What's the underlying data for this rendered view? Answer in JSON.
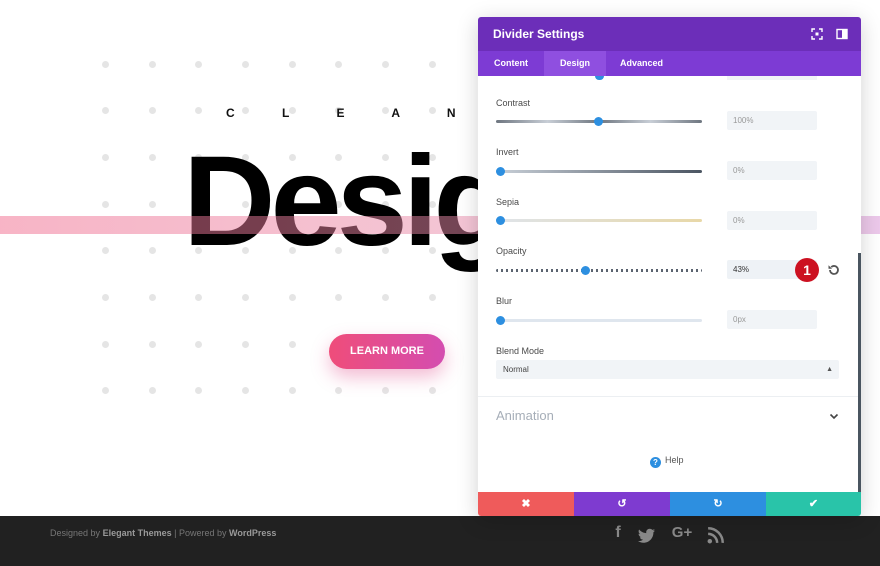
{
  "page": {
    "tagline": "C L E A N   &   W H",
    "headline": "Desig",
    "cta_label": "LEARN MORE"
  },
  "footer": {
    "designed_by": "Designed by",
    "elegant_themes": "Elegant Themes",
    "powered_by": "| Powered by",
    "wordpress": "WordPress",
    "social_icons": [
      "facebook-icon",
      "twitter-icon",
      "google-plus-icon",
      "rss-icon"
    ]
  },
  "panel": {
    "title": "Divider Settings",
    "tabs": [
      {
        "label": "Content",
        "active": false
      },
      {
        "label": "Design",
        "active": true
      },
      {
        "label": "Advanced",
        "active": false
      }
    ],
    "fields": {
      "contrast": {
        "label": "Contrast",
        "value": "100%",
        "level": 0.5
      },
      "invert": {
        "label": "Invert",
        "value": "0%",
        "level": 0
      },
      "sepia": {
        "label": "Sepia",
        "value": "0%",
        "level": 0
      },
      "opacity": {
        "label": "Opacity",
        "value": "43%",
        "level": 0.43
      },
      "blur": {
        "label": "Blur",
        "value": "0px",
        "level": 0
      }
    },
    "blend_mode": {
      "label": "Blend Mode",
      "value": "Normal"
    },
    "animation_label": "Animation",
    "help_label": "Help",
    "step_badge": "1",
    "colors": {
      "header": "#6c2eb9",
      "tabs": "#7d3bd4",
      "cancel": "#ef5b5b",
      "undo": "#7e3bd0",
      "redo": "#2d8fe0",
      "save": "#29c4a9",
      "accent": "#2d8fe0"
    }
  }
}
